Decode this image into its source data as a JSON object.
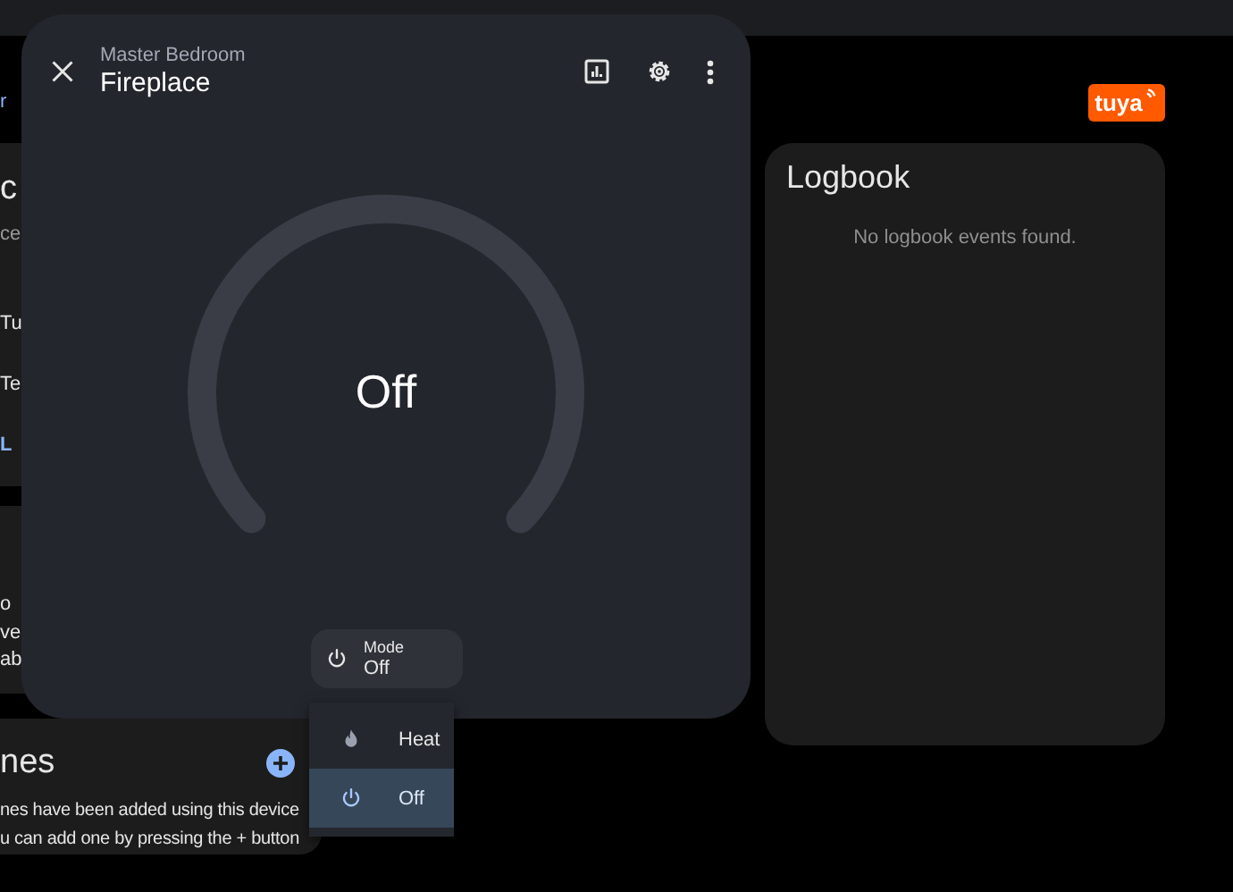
{
  "background": {
    "top_link": "r",
    "card_1": {
      "title": "c",
      "subtitle": "ce",
      "rows": [
        "Tu",
        "Te"
      ],
      "link": "L"
    },
    "card_2": {
      "lines": [
        "o",
        "ve",
        "ab"
      ]
    },
    "card_3": {
      "title": "nes",
      "lines": [
        "nes have been added using this device",
        "u can add one by pressing the + button"
      ]
    }
  },
  "logo": "tuya",
  "logbook": {
    "title": "Logbook",
    "empty_text": "No logbook events found."
  },
  "dialog": {
    "subtitle": "Master Bedroom",
    "title": "Fireplace",
    "state": "Off",
    "mode": {
      "label": "Mode",
      "value": "Off"
    },
    "options": [
      {
        "label": "Heat",
        "kind": "heat",
        "selected": false
      },
      {
        "label": "Off",
        "kind": "off",
        "selected": true
      }
    ]
  }
}
